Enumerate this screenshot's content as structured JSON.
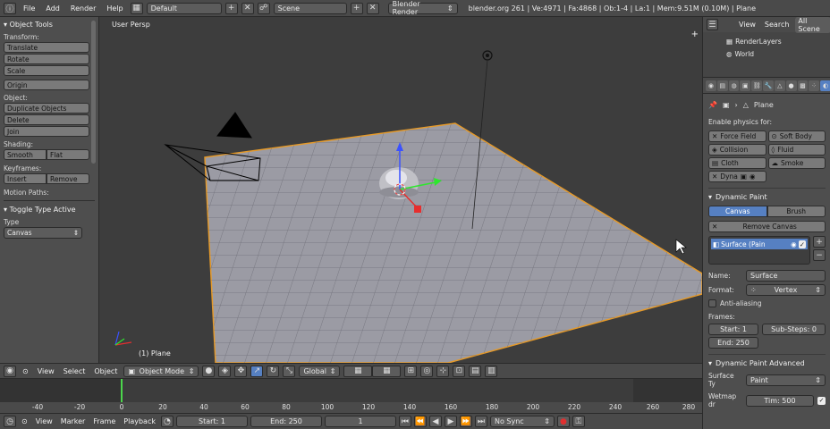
{
  "topbar": {
    "menus": [
      "File",
      "Add",
      "Render",
      "Help"
    ],
    "screen_layout": "Default",
    "scene": "Scene",
    "render_engine": "Blender Render",
    "stats": "blender.org 261 | Ve:4971 | Fa:4868 | Ob:1-4 | La:1 | Mem:9.51M (0.10M) | Plane"
  },
  "tool_shelf": {
    "title": "Object Tools",
    "transform_label": "Transform:",
    "translate": "Translate",
    "rotate": "Rotate",
    "scale": "Scale",
    "origin": "Origin",
    "object_label": "Object:",
    "duplicate_objects": "Duplicate Objects",
    "delete": "Delete",
    "join": "Join",
    "shading_label": "Shading:",
    "smooth": "Smooth",
    "flat": "Flat",
    "keyframes_label": "Keyframes:",
    "insert": "Insert",
    "remove": "Remove",
    "motion_paths_label": "Motion Paths:",
    "operator_title": "Toggle Type Active",
    "type_label": "Type",
    "type_value": "Canvas"
  },
  "viewport": {
    "view_name": "User Persp",
    "object_label": "(1) Plane"
  },
  "viewport_header": {
    "view": "View",
    "select": "Select",
    "object": "Object",
    "mode": "Object Mode",
    "orientation": "Global"
  },
  "timeline": {
    "ticks": [
      "-40",
      "-20",
      "0",
      "20",
      "40",
      "60",
      "80",
      "100",
      "120",
      "140",
      "160",
      "180",
      "200",
      "220",
      "240",
      "260",
      "280"
    ],
    "current_frame_marker": 0
  },
  "bottombar": {
    "view": "View",
    "marker": "Marker",
    "frame": "Frame",
    "playback": "Playback",
    "start": "Start: 1",
    "end": "End: 250",
    "current": "1",
    "sync": "No Sync"
  },
  "outliner": {
    "view": "View",
    "search": "Search",
    "filter": "All Scene",
    "items": [
      "RenderLayers",
      "World"
    ]
  },
  "properties": {
    "object_name": "Plane",
    "enable_physics": "Enable physics for:",
    "force_field": "Force Field",
    "soft_body": "Soft Body",
    "collision": "Collision",
    "fluid": "Fluid",
    "cloth": "Cloth",
    "smoke": "Smoke",
    "dyna": "Dyna",
    "dynamic_paint": "Dynamic Paint",
    "canvas": "Canvas",
    "brush": "Brush",
    "remove_canvas": "Remove Canvas",
    "surface_item": "Surface (Pain",
    "name_label": "Name:",
    "name_value": "Surface",
    "format_label": "Format:",
    "format_value": "Vertex",
    "anti_aliasing": "Anti-aliasing",
    "frames_label": "Frames:",
    "start": "Start: 1",
    "substeps": "Sub-Steps: 0",
    "end": "End: 250",
    "advanced": "Dynamic Paint Advanced",
    "surface_type_label": "Surface Ty",
    "surface_type_value": "Paint",
    "wetmap_label": "Wetmap dr",
    "time_value": "Tim: 500"
  }
}
